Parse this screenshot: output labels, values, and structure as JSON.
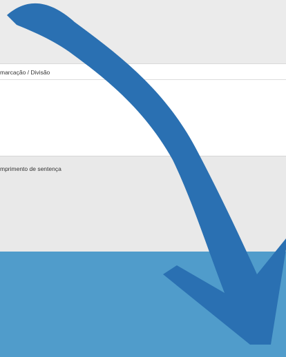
{
  "form": {
    "card_header_label": "marcação / Divisão",
    "section_label": "mprimento de sentença"
  },
  "colors": {
    "background": "#ebebeb",
    "card": "#ffffff",
    "footer": "#509ccb",
    "arrow": "#2a70b2"
  },
  "overlay": {
    "icon": "curved-arrow-down-icon"
  }
}
